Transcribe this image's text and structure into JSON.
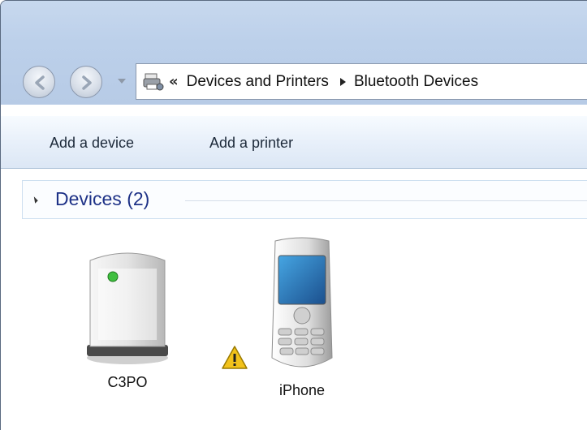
{
  "breadcrumb": {
    "overflow": "«",
    "items": [
      "Devices and Printers",
      "Bluetooth Devices"
    ]
  },
  "commands": {
    "add_device": "Add a device",
    "add_printer": "Add a printer"
  },
  "group": {
    "title": "Devices (2)"
  },
  "devices": [
    {
      "label": "C3PO",
      "icon": "bluetooth-adapter-icon"
    },
    {
      "label": "iPhone",
      "icon": "mobile-phone-icon",
      "warning": true
    }
  ],
  "colors": {
    "titlebar": "#bcd0ea",
    "group_title": "#1e3287",
    "warning": "#f2c21b"
  }
}
